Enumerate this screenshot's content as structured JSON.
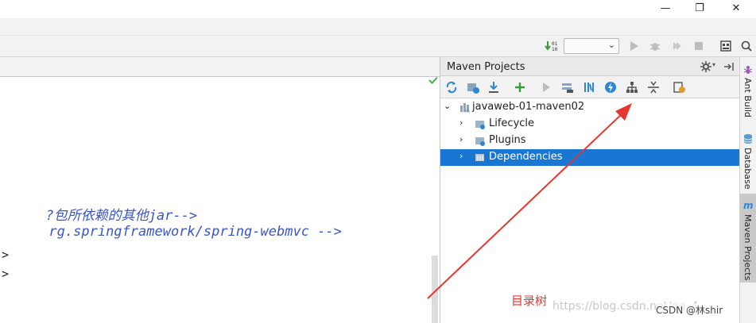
{
  "window": {
    "minimize_glyph": "—",
    "restore_glyph": "❐",
    "close_glyph": "✕"
  },
  "editor": {
    "lines": [
      "包所依赖的其他jar-->",
      "rg.springframework/spring-webmvc -->"
    ],
    "line_prefix_glyph": "?",
    "tag_glyph": ">"
  },
  "maven": {
    "title": "Maven Projects",
    "tree": [
      {
        "label": "javaweb-01-maven02",
        "expanded": true,
        "level": 0
      },
      {
        "label": "Lifecycle",
        "expanded": false,
        "level": 1
      },
      {
        "label": "Plugins",
        "expanded": false,
        "level": 1
      },
      {
        "label": "Dependencies",
        "expanded": false,
        "level": 1,
        "selected": true
      }
    ]
  },
  "side_tabs": [
    {
      "label": "Ant Build"
    },
    {
      "label": "Database"
    },
    {
      "label": "Maven Projects",
      "active": true
    }
  ],
  "annotation": {
    "text": "目录树",
    "color": "#e8362f"
  },
  "watermark": {
    "text": "https://blog.csdn.net/qq_4"
  },
  "credit": {
    "text": "CSDN @林shir"
  },
  "colors": {
    "selection": "#1976d2",
    "code_text": "#3a54c9",
    "run_green": "#3c9a3c"
  }
}
